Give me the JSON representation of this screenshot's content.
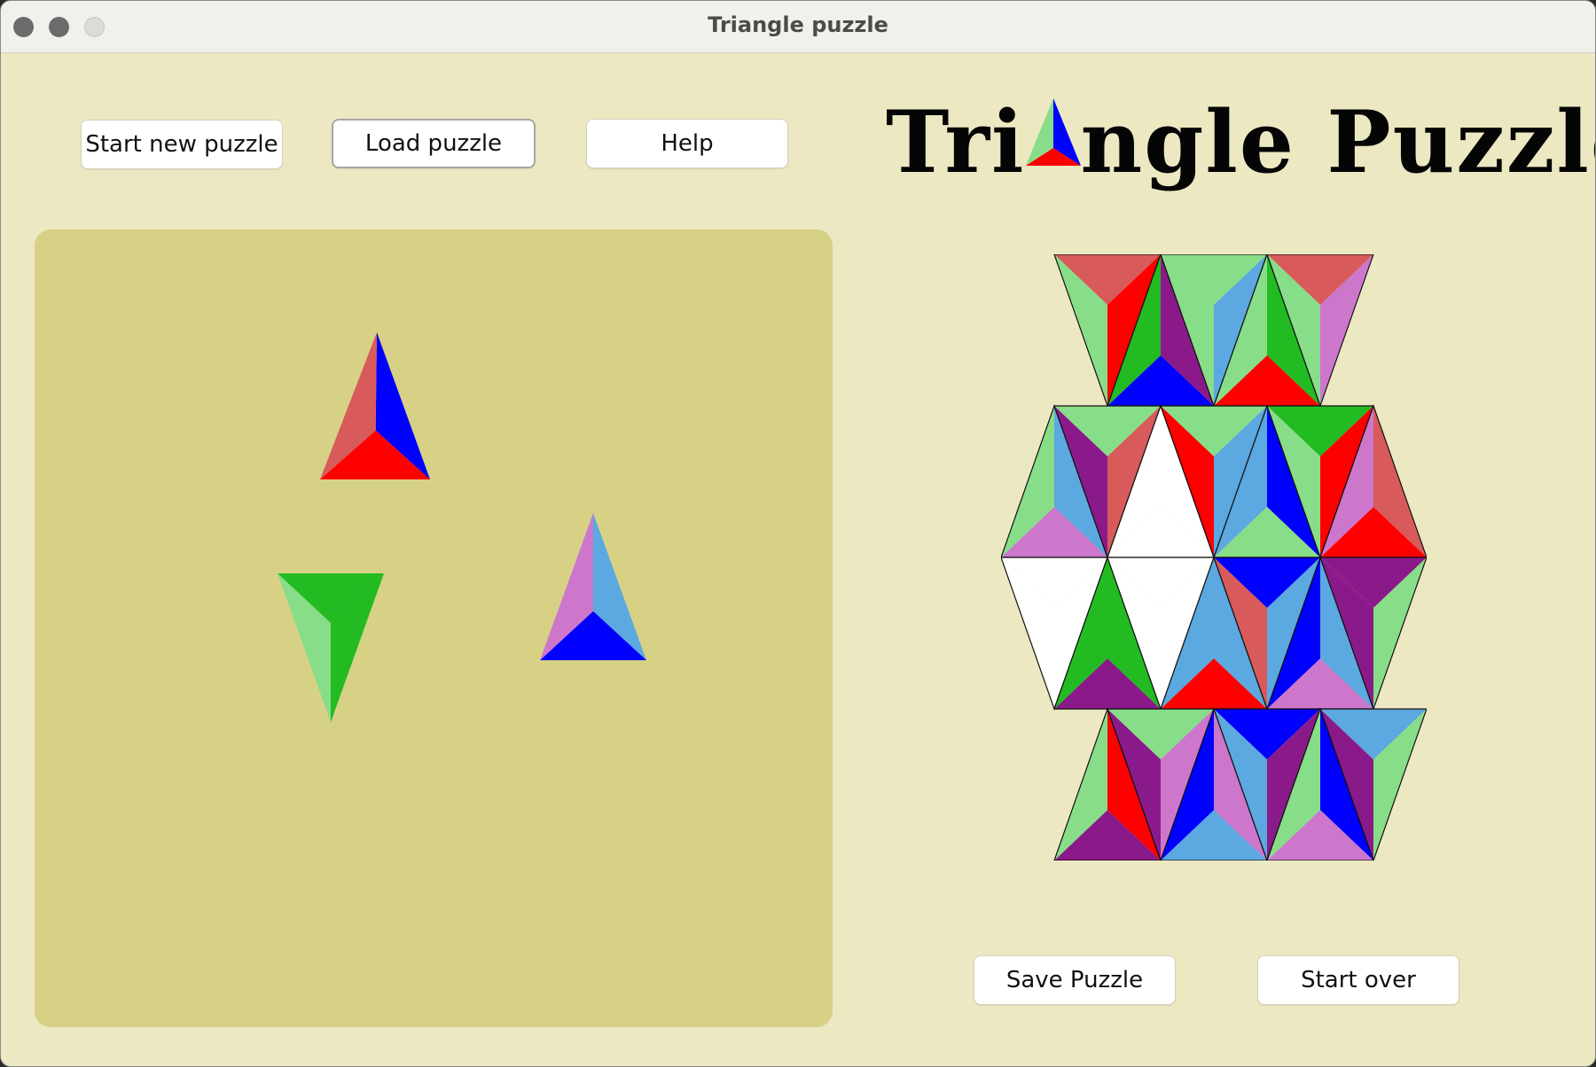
{
  "window": {
    "title": "Triangle puzzle"
  },
  "toolbar": {
    "start_new_label": "Start new puzzle",
    "load_label": "Load puzzle",
    "help_label": "Help"
  },
  "logo": {
    "before": "Tri",
    "after": "ngle Puzzle",
    "alt_letter": "A"
  },
  "footer": {
    "save_label": "Save Puzzle",
    "start_over_label": "Start over"
  },
  "colors": {
    "background": "#ece8c2",
    "tray": "#d7d186",
    "red": "#ff0000",
    "salmon": "#d85a5a",
    "blue": "#0000ff",
    "light_blue": "#5ca8e0",
    "green": "#22bb22",
    "light_green": "#88dd88",
    "purple": "#8a1a8a",
    "pink": "#cc77cc",
    "white": "#ffffff"
  },
  "tray_pieces": [
    {
      "orientation": "up",
      "left": "salmon",
      "right": "blue",
      "base": "red"
    },
    {
      "orientation": "down",
      "left": "light_green",
      "right": "green",
      "top": "green"
    },
    {
      "orientation": "up",
      "left": "pink",
      "right": "light_blue",
      "base": "blue"
    }
  ],
  "board_rows": [
    [
      {
        "o": "down",
        "a": "salmon",
        "b": "red",
        "c": "light_green"
      },
      {
        "o": "up",
        "a": "purple",
        "b": "blue",
        "c": "green"
      },
      {
        "o": "down",
        "a": "light_green",
        "b": "light_blue",
        "c": "light_green"
      },
      {
        "o": "up",
        "a": "green",
        "b": "red",
        "c": "light_green"
      },
      {
        "o": "down",
        "a": "salmon",
        "b": "pink",
        "c": "light_green"
      }
    ],
    [
      {
        "o": "up",
        "a": "light_blue",
        "b": "pink",
        "c": "light_green"
      },
      {
        "o": "down",
        "a": "light_green",
        "b": "salmon",
        "c": "purple"
      },
      {
        "o": "up",
        "a": "white",
        "b": "white",
        "c": "white"
      },
      {
        "o": "down",
        "a": "light_green",
        "b": "light_blue",
        "c": "red"
      },
      {
        "o": "up",
        "a": "blue",
        "b": "light_green",
        "c": "light_blue"
      },
      {
        "o": "down",
        "a": "green",
        "b": "red",
        "c": "light_green"
      },
      {
        "o": "up",
        "a": "salmon",
        "b": "red",
        "c": "pink"
      }
    ],
    [
      {
        "o": "down",
        "a": "white",
        "b": "white",
        "c": "white"
      },
      {
        "o": "up",
        "a": "green",
        "b": "purple",
        "c": "green"
      },
      {
        "o": "down",
        "a": "white",
        "b": "white",
        "c": "white"
      },
      {
        "o": "up",
        "a": "light_blue",
        "b": "red",
        "c": "light_blue"
      },
      {
        "o": "down",
        "a": "blue",
        "b": "light_blue",
        "c": "salmon"
      },
      {
        "o": "up",
        "a": "light_blue",
        "b": "pink",
        "c": "blue"
      },
      {
        "o": "down",
        "a": "purple",
        "b": "light_green",
        "c": "purple"
      }
    ],
    [
      {
        "o": "up",
        "a": "red",
        "b": "purple",
        "c": "light_green"
      },
      {
        "o": "down",
        "a": "light_green",
        "b": "pink",
        "c": "purple"
      },
      {
        "o": "up",
        "a": "pink",
        "b": "light_blue",
        "c": "blue"
      },
      {
        "o": "down",
        "a": "blue",
        "b": "purple",
        "c": "light_blue"
      },
      {
        "o": "up",
        "a": "blue",
        "b": "pink",
        "c": "light_green"
      },
      {
        "o": "down",
        "a": "light_blue",
        "b": "light_green",
        "c": "purple"
      }
    ]
  ]
}
